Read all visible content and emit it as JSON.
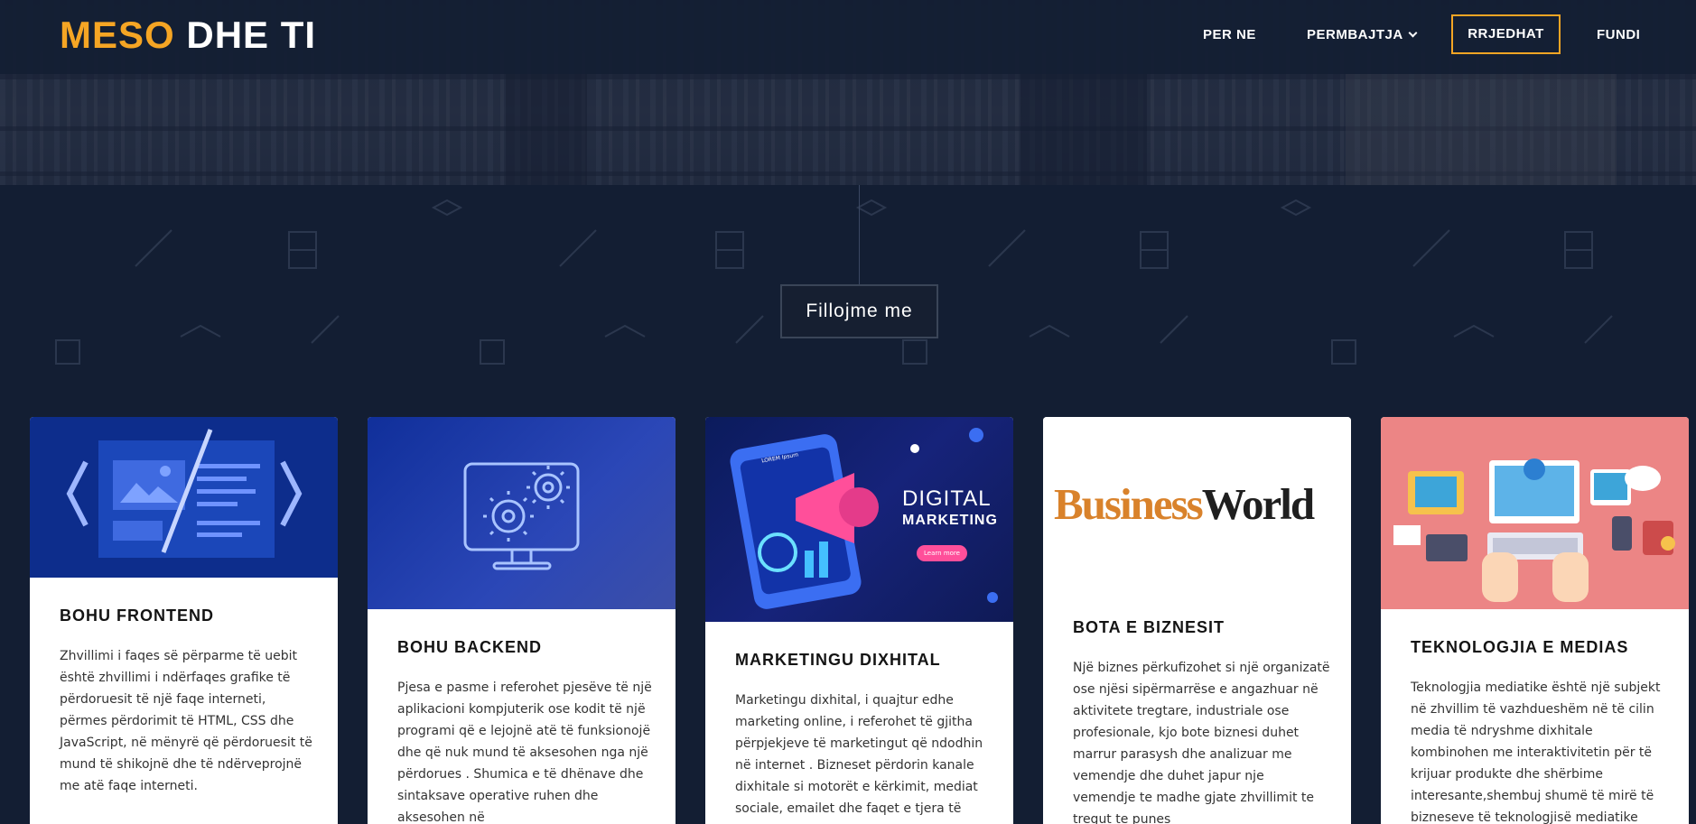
{
  "logo": {
    "part1": "MESO",
    "part2": "DHE TI"
  },
  "nav": {
    "items": [
      {
        "label": "PER NE"
      },
      {
        "label": "PERMBAJTJA"
      },
      {
        "label": "RRJEDHAT"
      },
      {
        "label": "FUNDI"
      }
    ]
  },
  "colors": {
    "accent": "#f5a524",
    "background": "#131e33",
    "card": "#ffffff"
  },
  "start": {
    "label": "Fillojme me"
  },
  "cards": [
    {
      "title": "BOHU FRONTEND",
      "text": "Zhvillimi i faqes së përparme të uebit është zhvillimi i ndërfaqes grafike të përdoruesit të një faqe interneti, përmes përdorimit të HTML, CSS dhe JavaScript, në mënyrë që përdoruesit të mund të shikojnë dhe të ndërveprojnë me atë faqe interneti."
    },
    {
      "title": "BOHU BACKEND",
      "text": "Pjesa e pasme i referohet pjesëve të një aplikacioni kompjuterik ose kodit të një programi që e lejojnë atë të funksionojë dhe që nuk mund të aksesohen nga një përdorues . Shumica e të dhënave dhe sintaksave operative ruhen dhe aksesohen në"
    },
    {
      "title": "MARKETINGU DIXHITAL",
      "image_text": {
        "line1": "DIGITAL",
        "line2": "MARKETING",
        "button": "Learn more",
        "phone": "LOREM Ipsum"
      },
      "text": "Marketingu dixhital, i quajtur edhe marketing online, i referohet të gjitha përpjekjeve të marketingut që ndodhin në internet . Bizneset përdorin kanale dixhitale si motorët e kërkimit, mediat sociale, emailet dhe faqet e tjera të"
    },
    {
      "title": "BOTA E BIZNESIT",
      "image_text": {
        "brand1": "Business",
        "brand2": "World"
      },
      "text": "Një biznes përkufizohet si një organizatë ose njësi sipërmarrëse e angazhuar në aktivitete tregtare, industriale ose profesionale, kjo bote biznesi duhet marrur parasysh dhe analizuar me vemendje dhe duhet japur nje vemendje te madhe gjate zhvillimit te tregut te punes"
    },
    {
      "title": "TEKNOLOGJIA E MEDIAS",
      "text": "Teknologjia mediatike është një subjekt në zhvillim të vazhdueshëm në të cilin media të ndryshme dixhitale kombinohen me interaktivitetin për të krijuar produkte dhe shërbime interesante,shembuj shumë të mirë të bizneseve të teknologjisë mediatike"
    }
  ]
}
